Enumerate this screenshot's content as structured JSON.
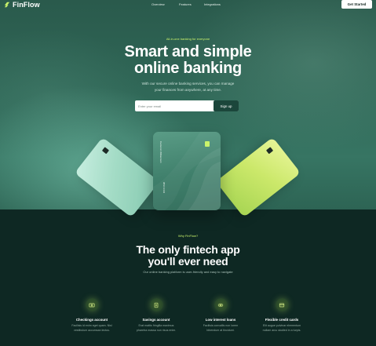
{
  "brand": {
    "name": "FinFlow",
    "accent": "#c9f26b",
    "dark_bg": "#0e2823"
  },
  "nav": {
    "items": [
      {
        "label": "Overview"
      },
      {
        "label": "Features"
      },
      {
        "label": "Integrations"
      }
    ],
    "cta_label": "Get Started"
  },
  "hero": {
    "eyebrow": "All-in-one banking for everyone",
    "title_line1": "Smart and simple",
    "title_line2": "online banking",
    "subtitle_line1": "With our secure online banking services, you can manage",
    "subtitle_line2": "your finances from anywhere, at any time.",
    "email_placeholder": "Enter your email",
    "signup_label": "Sign up"
  },
  "cards": {
    "center_holder": "Cameron Williamson",
    "center_number": "9834 3432"
  },
  "why": {
    "eyebrow": "Why FinFlow?",
    "title_line1": "The only fintech app",
    "title_line2": "you'll ever need",
    "subtitle": "Our online banking platform is user-friendly and easy to navigate"
  },
  "features": [
    {
      "icon": "money-icon",
      "title": "Checkings account",
      "desc_line1": "Facilisis id enim eget quam. Nisl",
      "desc_line2": "vestibulum accumsan lectus."
    },
    {
      "icon": "piggy-bank-icon",
      "title": "Savings account",
      "desc_line1": "Erat mattis fringilla maximus",
      "desc_line2": "pharetra massa nun risus enim."
    },
    {
      "icon": "loan-icon",
      "title": "Low interest loans",
      "desc_line1": "Facilisis convallis non lorem",
      "desc_line2": "bibendum at tincidunt."
    },
    {
      "icon": "credit-card-icon",
      "title": "Flexible credit cards",
      "desc_line1": "Elit augue pulvinar elementum",
      "desc_line2": "nullam arcu studied in a turpis."
    }
  ]
}
